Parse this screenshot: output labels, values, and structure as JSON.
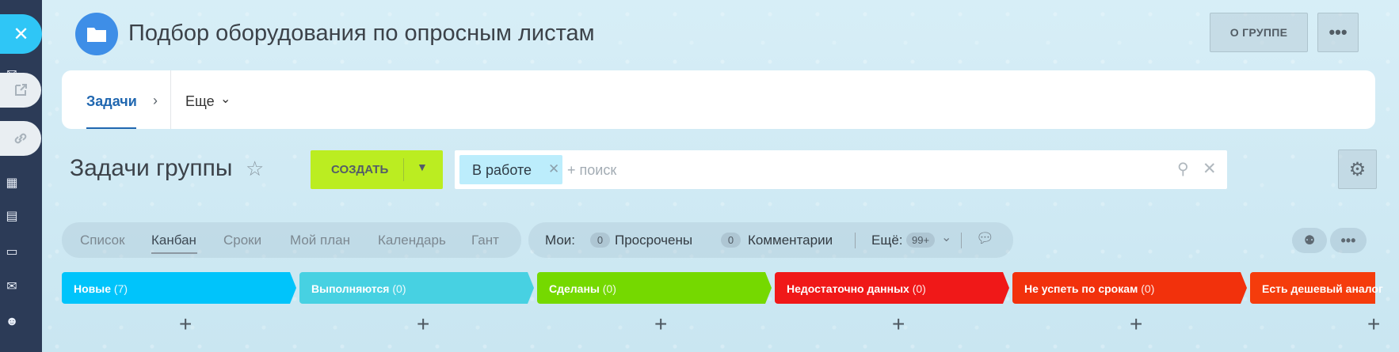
{
  "header": {
    "title": "Подбор оборудования по опросным листам",
    "about_label": "О ГРУППЕ",
    "more_label": "•••"
  },
  "tabs": {
    "tasks_label": "Задачи",
    "more_label": "Еще"
  },
  "toolbar": {
    "section_title": "Задачи группы",
    "create_label": "СОЗДАТЬ",
    "filter_chip": "В работе",
    "search_placeholder": "+ поиск"
  },
  "views": {
    "items": [
      "Список",
      "Канбан",
      "Сроки",
      "Мой план",
      "Календарь",
      "Гант"
    ],
    "active": "Канбан"
  },
  "counters": {
    "mine_label": "Мои:",
    "overdue_count": "0",
    "overdue_label": "Просрочены",
    "comments_count": "0",
    "comments_label": "Комментарии",
    "more_label": "Ещё:",
    "more_count": "99+"
  },
  "kanban": {
    "columns": [
      {
        "title": "Новые",
        "count": "(7)",
        "color": "#00c4fb"
      },
      {
        "title": "Выполняются",
        "count": "(0)",
        "color": "#47d1e2"
      },
      {
        "title": "Сделаны",
        "count": "(0)",
        "color": "#75d900"
      },
      {
        "title": "Недостаточно данных",
        "count": "(0)",
        "color": "#f01818"
      },
      {
        "title": "Не успеть по срокам",
        "count": "(0)",
        "color": "#f2310c"
      },
      {
        "title": "Есть дешевый аналог",
        "count": "",
        "color": "#f53c0c"
      }
    ],
    "add_symbol": "+"
  },
  "icons": {
    "close": "close-icon",
    "folder": "folder-icon",
    "star": "star-icon",
    "gear": "gear-icon",
    "search": "search-icon",
    "robot": "robot-icon",
    "chat": "chat-icon"
  },
  "colors": {
    "accent_blue": "#2fc6f6",
    "create_green": "#bbed21",
    "sidebar_dark": "#2c3b57",
    "tab_active": "#2067b0"
  }
}
